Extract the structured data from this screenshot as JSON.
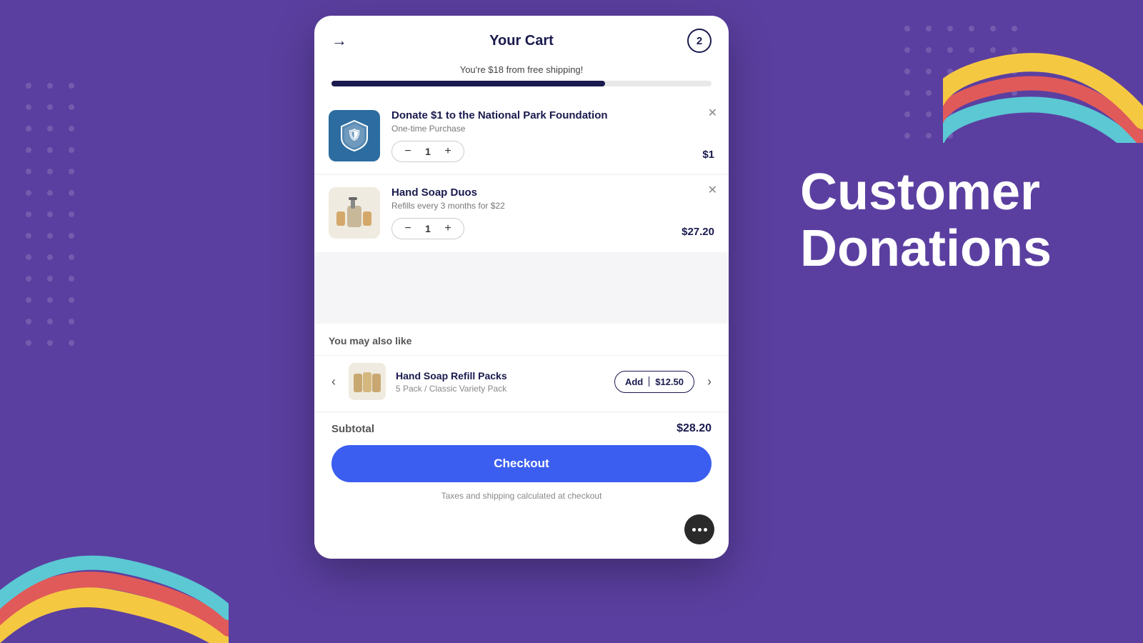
{
  "background": {
    "color": "#5b3fa0"
  },
  "promo": {
    "title_line1": "Customer",
    "title_line2": "Donations"
  },
  "cart": {
    "title": "Your Cart",
    "item_count": "2",
    "back_icon": "→",
    "shipping_text": "You're $18 from free shipping!",
    "progress_percent": 72,
    "items": [
      {
        "id": "donation",
        "name": "Donate $1 to the National Park Foundation",
        "subtitle": "One-time Purchase",
        "quantity": 1,
        "price": "$1",
        "image_type": "shield"
      },
      {
        "id": "soap-duos",
        "name": "Hand Soap Duos",
        "subtitle": "Refills every 3 months for $22",
        "quantity": 1,
        "price": "$27.20",
        "image_type": "soap"
      }
    ],
    "also_like": {
      "section_title": "You may also like",
      "product": {
        "name": "Hand Soap Refill Packs",
        "variant": "5 Pack / Classic Variety Pack",
        "add_label": "Add",
        "price_label": "$12.50",
        "image_type": "soap-refill"
      }
    },
    "subtotal_label": "Subtotal",
    "subtotal_amount": "$28.20",
    "checkout_label": "Checkout",
    "tax_note": "Taxes and shipping calculated at checkout"
  }
}
